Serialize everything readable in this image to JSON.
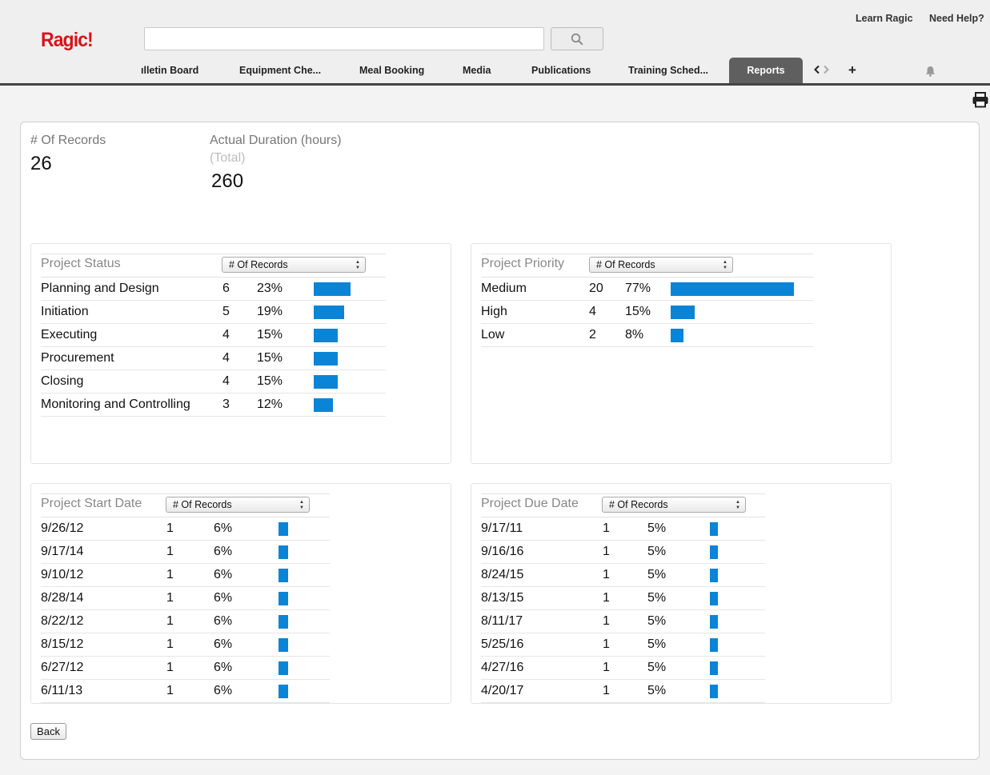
{
  "header": {
    "logo": "Ragic!",
    "search": {
      "value": "",
      "placeholder": ""
    },
    "links": [
      "Learn Ragic",
      "Need Help?"
    ],
    "tabs": [
      "ılletin Board",
      "Equipment Che...",
      "Meal Booking",
      "Media",
      "Publications",
      "Training Sched...",
      "Reports"
    ],
    "active_tab": "Reports",
    "add_tab": "+"
  },
  "summary": {
    "records_label": "# Of Records",
    "records_value": "26",
    "duration_label": "Actual Duration (hours)",
    "duration_sub": "(Total)",
    "duration_value": "260"
  },
  "select_label": "# Of Records",
  "back_label": "Back",
  "accent_color": "#0a84d6",
  "chart_data": [
    {
      "type": "table",
      "title": "Project Status",
      "rows": [
        {
          "label": "Planning and Design",
          "count": 6,
          "pct": "23%",
          "value": 23
        },
        {
          "label": "Initiation",
          "count": 5,
          "pct": "19%",
          "value": 19
        },
        {
          "label": "Executing",
          "count": 4,
          "pct": "15%",
          "value": 15
        },
        {
          "label": "Procurement",
          "count": 4,
          "pct": "15%",
          "value": 15
        },
        {
          "label": "Closing",
          "count": 4,
          "pct": "15%",
          "value": 15
        },
        {
          "label": "Monitoring and Controlling",
          "count": 3,
          "pct": "12%",
          "value": 12
        }
      ]
    },
    {
      "type": "table",
      "title": "Project Priority",
      "rows": [
        {
          "label": "Medium",
          "count": 20,
          "pct": "77%",
          "value": 77
        },
        {
          "label": "High",
          "count": 4,
          "pct": "15%",
          "value": 15
        },
        {
          "label": "Low",
          "count": 2,
          "pct": "8%",
          "value": 8
        }
      ]
    },
    {
      "type": "table",
      "title": "Project Start Date",
      "rows": [
        {
          "label": "9/26/12",
          "count": 1,
          "pct": "6%",
          "value": 6
        },
        {
          "label": "9/17/14",
          "count": 1,
          "pct": "6%",
          "value": 6
        },
        {
          "label": "9/10/12",
          "count": 1,
          "pct": "6%",
          "value": 6
        },
        {
          "label": "8/28/14",
          "count": 1,
          "pct": "6%",
          "value": 6
        },
        {
          "label": "8/22/12",
          "count": 1,
          "pct": "6%",
          "value": 6
        },
        {
          "label": "8/15/12",
          "count": 1,
          "pct": "6%",
          "value": 6
        },
        {
          "label": "6/27/12",
          "count": 1,
          "pct": "6%",
          "value": 6
        },
        {
          "label": "6/11/13",
          "count": 1,
          "pct": "6%",
          "value": 6
        }
      ]
    },
    {
      "type": "table",
      "title": "Project Due Date",
      "rows": [
        {
          "label": "9/17/11",
          "count": 1,
          "pct": "5%",
          "value": 5
        },
        {
          "label": "9/16/16",
          "count": 1,
          "pct": "5%",
          "value": 5
        },
        {
          "label": "8/24/15",
          "count": 1,
          "pct": "5%",
          "value": 5
        },
        {
          "label": "8/13/15",
          "count": 1,
          "pct": "5%",
          "value": 5
        },
        {
          "label": "8/11/17",
          "count": 1,
          "pct": "5%",
          "value": 5
        },
        {
          "label": "5/25/16",
          "count": 1,
          "pct": "5%",
          "value": 5
        },
        {
          "label": "4/27/16",
          "count": 1,
          "pct": "5%",
          "value": 5
        },
        {
          "label": "4/20/17",
          "count": 1,
          "pct": "5%",
          "value": 5
        }
      ]
    }
  ]
}
